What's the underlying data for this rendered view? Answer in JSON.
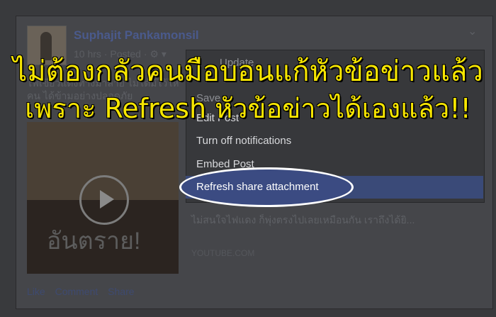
{
  "post": {
    "author": "Suphajit Pankamonsil",
    "meta": "10 hrs · Posted · ⚙ ▾",
    "snippet": "ไฟเขียวแดงทางม้าลาย ไม่ได้มีไว้ให้คน ได้ข้ามอย่างปลอดภัย",
    "video_overlay_text": "อันตราย!",
    "attachment_description": "ไม่สนใจไฟแดง ก็พุ่งตรงไปเลยเหมือนกัน เราถึงได้ยิ...",
    "source": "YOUTUBE.COM",
    "actions": [
      "Like",
      "Comment",
      "Share"
    ]
  },
  "menu": {
    "items": [
      {
        "label": "Update",
        "dim": true
      },
      {
        "label": "Save",
        "dim": true
      },
      {
        "label": "Edit Post",
        "dim": false
      },
      {
        "label": "Turn off notifications",
        "dim": false
      },
      {
        "label": "Embed Post",
        "dim": false
      },
      {
        "label": "Refresh share attachment",
        "dim": false,
        "highlighted": true
      }
    ]
  },
  "overlay": {
    "line1": "ไม่ต้องกลัวคนมือบอนแก้หัวข้อข่าวแล้ว",
    "line2": "เพราะ Refresh หัวข้อข่าวได้เองแล้ว!!"
  },
  "colors": {
    "overlay_text": "#f7e600",
    "highlight": "#3b4b82"
  }
}
